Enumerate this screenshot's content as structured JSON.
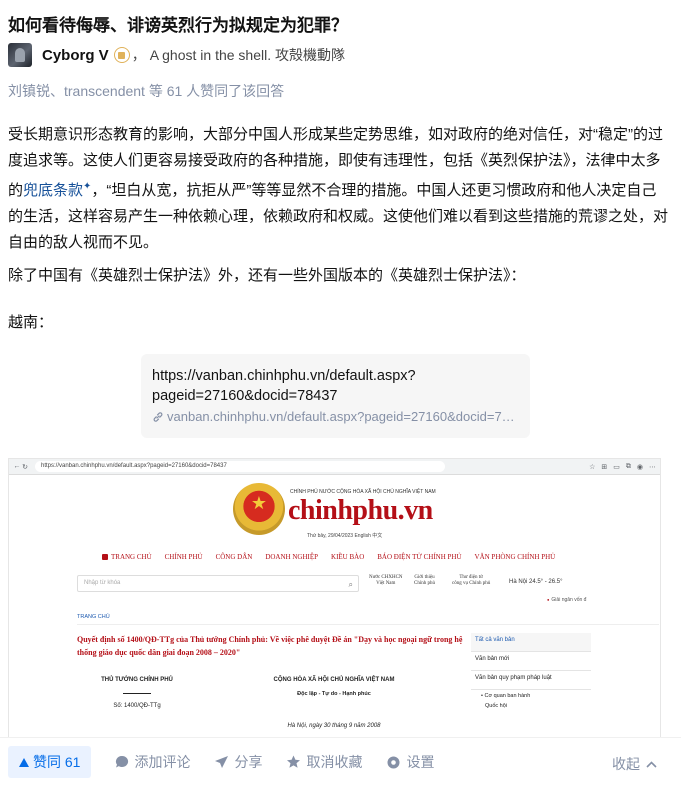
{
  "question": {
    "title": "如何看待侮辱、诽谤英烈行为拟规定为犯罪？"
  },
  "author": {
    "name": "Cyborg V",
    "separator": "，",
    "bio": "A ghost in the shell. 攻殻機動隊"
  },
  "vote_summary": "刘镇锐、transcendent 等 61 人赞同了该回答",
  "content": {
    "p1": {
      "a": "受长期意识形态教育的影响，大部分中国人形成某些定势思维，如对政府的绝对信任，对“稳定”的过度追求等。这使人们更容易接受政府的各种措施，即使有违理性，包括《英烈保护法》，法律中太多的",
      "link": "兜底条款",
      "b": "，“坦白从宽，抗拒从严”等等显然不合理的措施。中国人还更习惯政府和他人决定自己的生活，这样容易产生一种依赖心理，依赖政府和权威。这使他们难以看到这些措施的荒谬之处，对自由的敌人视而不见。"
    },
    "p2": "除了中国有《英雄烈士保护法》外，还有一些外国版本的《英雄烈士保护法》：",
    "p3": "越南：",
    "link_card": {
      "title_line1": "https://vanban.chinhphu.vn/default.aspx?",
      "title_line2": "pageid=27160&docid=78437",
      "url": "vanban.chinhphu.vn/default.aspx?pageid=27160&docid=7…"
    }
  },
  "screenshot": {
    "address": "https://vanban.chinhphu.vn/default.aspx?pageid=27160&docid=78437",
    "header_small": "CHÍNH PHỦ NƯỚC CỘNG HÒA XÃ HỘI CHỦ NGHĨA VIỆT NAM",
    "brand": "chinhphu.vn",
    "date_line": "Thứ bảy, 29/04/2023   English   中文",
    "nav": [
      "TRANG CHỦ",
      "CHÍNH PHỦ",
      "CÔNG DÂN",
      "DOANH NGHIỆP",
      "KIỀU BÀO",
      "BÁO ĐIỆN TỬ CHÍNH PHỦ",
      "VĂN PHÒNG CHÍNH PHỦ"
    ],
    "search_placeholder": "Nhập từ khóa",
    "quick_links": [
      {
        "l1": "Nước CHXHCN",
        "l2": "Việt Nam"
      },
      {
        "l1": "Giới thiệu",
        "l2": "Chính phủ"
      },
      {
        "l1": "Thư điện tử",
        "l2": "công vụ Chính phủ"
      }
    ],
    "weather": "Hà Nội   24.5° - 26.5°",
    "price": "Giải ngân vốn đ",
    "breadcrumb": "TRANG CHỦ",
    "article_title": "Quyết định số 1400/QĐ-TTg của Thủ tướng Chính phủ: Về việc phê duyệt Đề án \"Dạy và học ngoại ngữ trong hệ thống giáo dục quốc dân giai đoạn 2008 – 2020\"",
    "doc_left_title": "THỦ TƯỚNG CHÍNH PHỦ",
    "doc_left_number": "Số: 1400/QĐ-TTg",
    "doc_right_title": "CỘNG HÒA XÃ HỘI CHỦ NGHĨA VIỆT NAM",
    "doc_right_motto": "Độc lập - Tự do - Hạnh phúc",
    "doc_right_date": "Hà Nội, ngày  30  tháng  9 năm 2008",
    "sidebar": {
      "items": [
        "Tất cả văn bản",
        "Văn bản mới",
        "Văn bản quy phạm pháp luật"
      ],
      "sub": "Cơ quan ban hành",
      "sub2": "Quốc hội"
    }
  },
  "actions": {
    "vote": "赞同 61",
    "comment": "添加评论",
    "share": "分享",
    "unfavorite": "取消收藏",
    "settings": "设置",
    "collapse": "收起"
  },
  "colors": {
    "accent": "#056de8",
    "link": "#175199",
    "muted": "#8590a6",
    "gov_red": "#b40f17"
  }
}
